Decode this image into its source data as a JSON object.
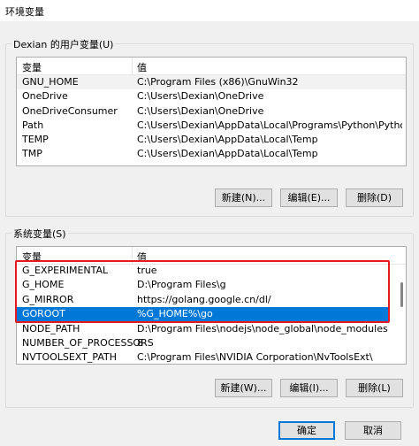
{
  "window": {
    "title": "环境变量"
  },
  "user_vars": {
    "group_label": "Dexian 的用户变量(U)",
    "columns": [
      "变量",
      "值"
    ],
    "rows": [
      {
        "name": "GNU_HOME",
        "value": "C:\\Program Files (x86)\\GnuWin32"
      },
      {
        "name": "OneDrive",
        "value": "C:\\Users\\Dexian\\OneDrive"
      },
      {
        "name": "OneDriveConsumer",
        "value": "C:\\Users\\Dexian\\OneDrive"
      },
      {
        "name": "Path",
        "value": "C:\\Users\\Dexian\\AppData\\Local\\Programs\\Python\\Python37\\..."
      },
      {
        "name": "TEMP",
        "value": "C:\\Users\\Dexian\\AppData\\Local\\Temp"
      },
      {
        "name": "TMP",
        "value": "C:\\Users\\Dexian\\AppData\\Local\\Temp"
      }
    ],
    "buttons": {
      "new": "新建(N)...",
      "edit": "编辑(E)...",
      "delete": "删除(D)"
    }
  },
  "system_vars": {
    "group_label": "系统变量(S)",
    "columns": [
      "变量",
      "值"
    ],
    "rows": [
      {
        "name": "G_EXPERIMENTAL",
        "value": "true"
      },
      {
        "name": "G_HOME",
        "value": "D:\\Program Files\\g"
      },
      {
        "name": "G_MIRROR",
        "value": "https://golang.google.cn/dl/"
      },
      {
        "name": "GOROOT",
        "value": "%G_HOME%\\go"
      },
      {
        "name": "NODE_PATH",
        "value": "D:\\Program Files\\nodejs\\node_global\\node_modules"
      },
      {
        "name": "NUMBER_OF_PROCESSORS",
        "value": "8"
      },
      {
        "name": "NVTOOLSEXT_PATH",
        "value": "C:\\Program Files\\NVIDIA Corporation\\NvToolsExt\\"
      }
    ],
    "selected_row": "GOROOT",
    "buttons": {
      "new": "新建(W)...",
      "edit": "编辑(I)...",
      "delete": "删除(L)"
    }
  },
  "footer": {
    "ok": "确定",
    "cancel": "取消"
  },
  "colors": {
    "selection": "#0078d7",
    "annotation": "#e8191e"
  }
}
